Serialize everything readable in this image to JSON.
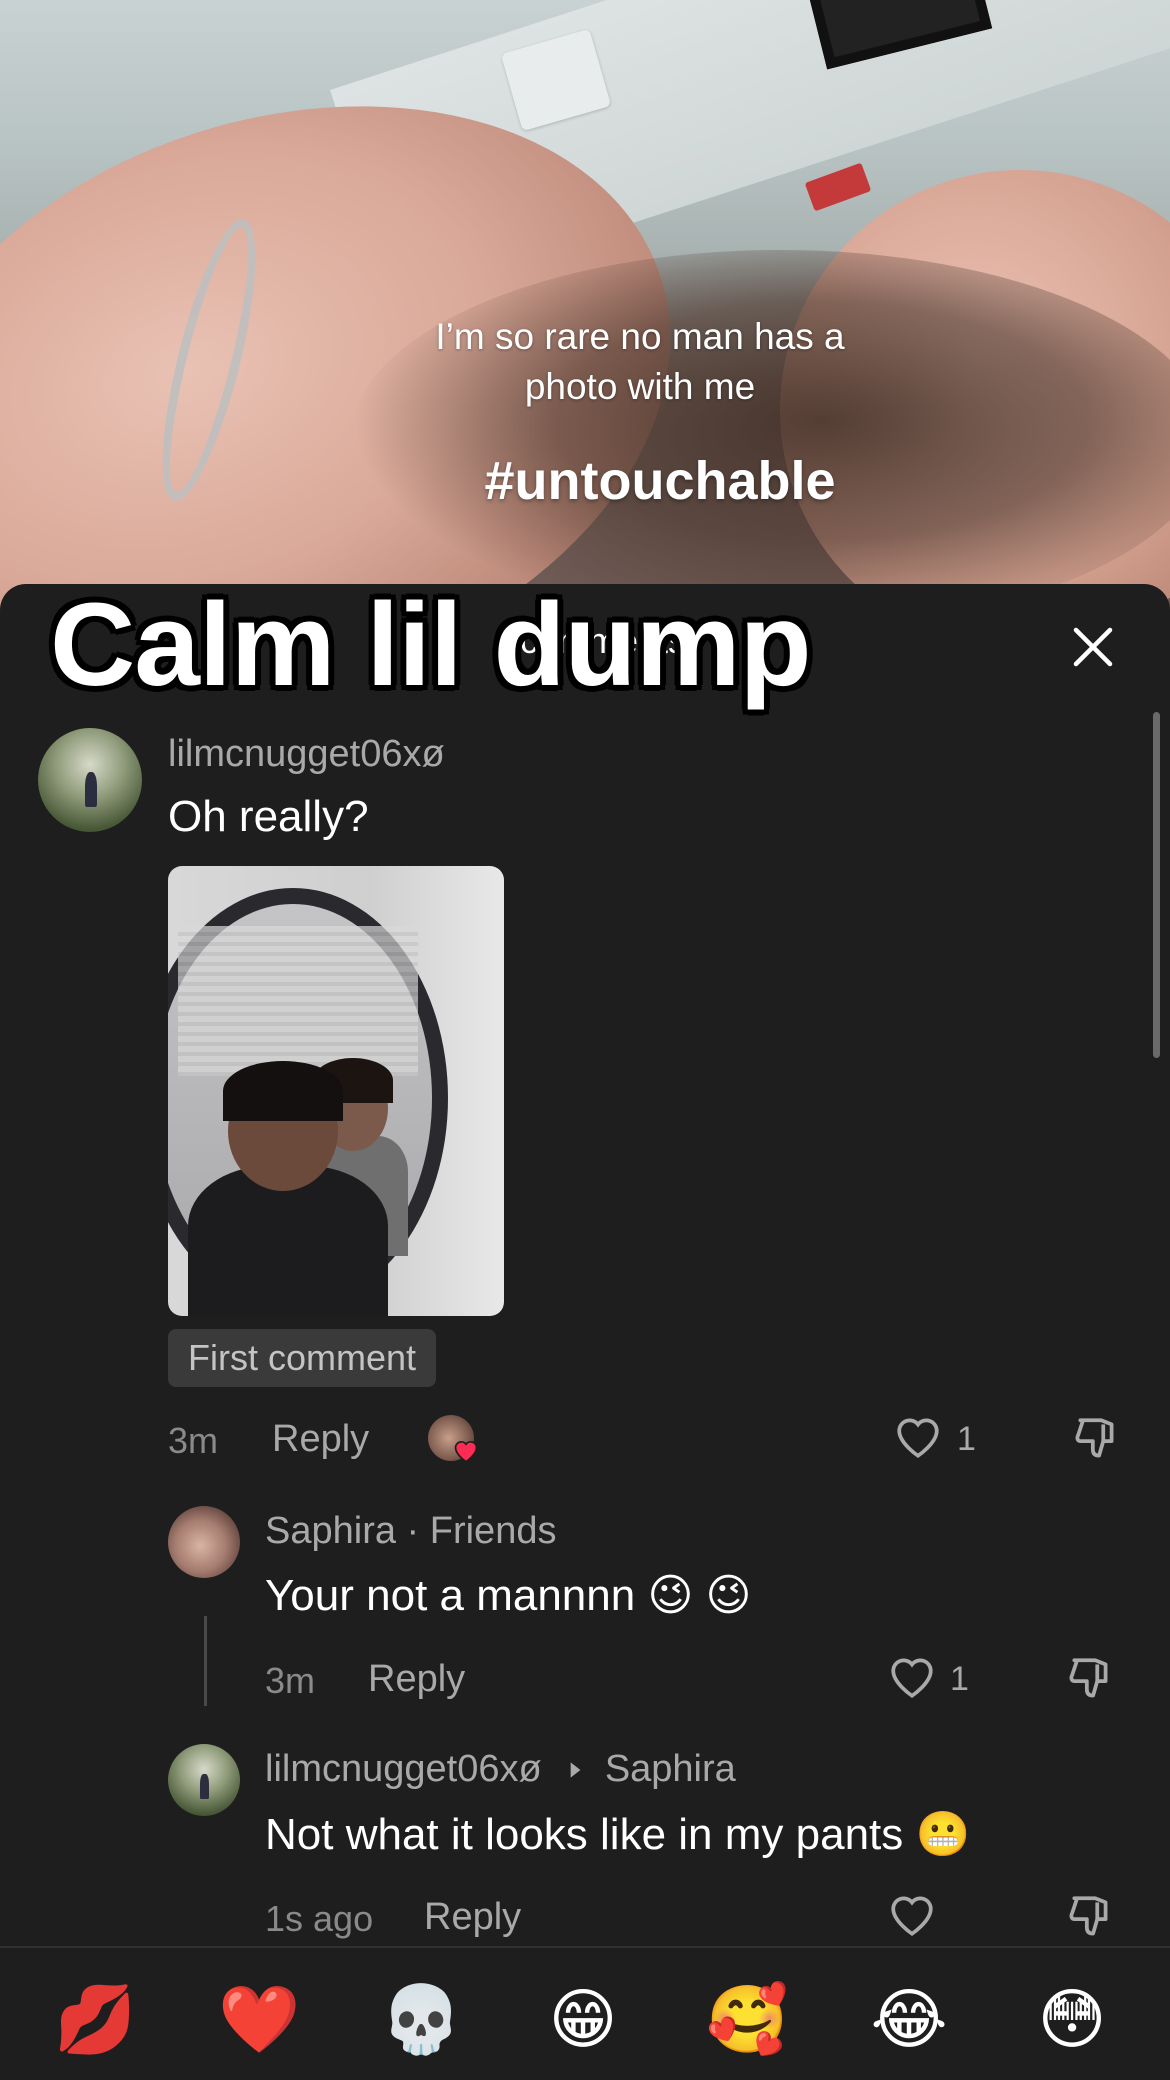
{
  "video": {
    "caption_line1": "I’m so rare no man has a",
    "caption_line2": "photo with me",
    "hashtag": "#untouchable"
  },
  "sheet": {
    "title": "comments",
    "overlay_text": "Calm lil dump"
  },
  "comments": [
    {
      "username": "lilmcnugget06xø",
      "text": "Oh really?",
      "badge": "First comment",
      "time": "3m",
      "reply_label": "Reply",
      "likes": "1",
      "reaction": "heart"
    },
    {
      "username": "Saphira · Friends",
      "text": "Your not a mannnn 😉 😉",
      "time": "3m",
      "reply_label": "Reply",
      "likes": "1"
    },
    {
      "username": "lilmcnugget06xø",
      "reply_to": "Saphira",
      "text": "Not what it looks like in my pants 😬",
      "time": "1s ago",
      "reply_label": "Reply",
      "likes": ""
    }
  ],
  "emoji_bar": [
    "💋",
    "❤️",
    "💀",
    "😁",
    "🥰",
    "😂",
    "😳"
  ],
  "colors": {
    "sheet_bg": "#1e1e1e",
    "text_secondary": "#a9a9a9",
    "heart_red": "#fe2c55"
  }
}
